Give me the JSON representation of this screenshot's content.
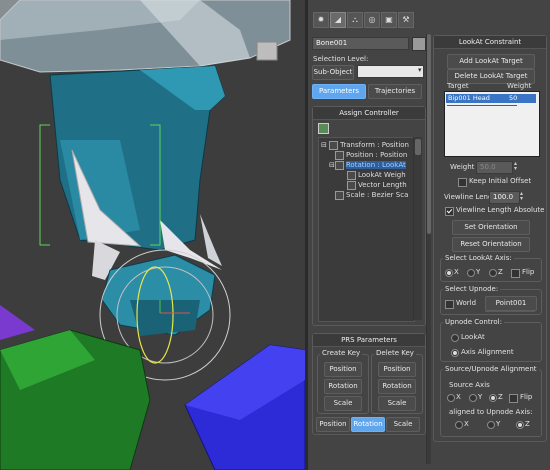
{
  "modify_panel": {
    "object_name": "Bone001",
    "selection_level_label": "Selection Level:",
    "sub_object_label": "Sub-Object",
    "sub_object_value": "",
    "tabs": {
      "parameters": "Parameters",
      "trajectories": "Trajectories"
    },
    "assign_controller": {
      "title": "Assign Controller",
      "tree": [
        "Transform : Position",
        "Position : Position",
        "Rotation : LookAt",
        "LookAt Weigh",
        "Vector Length",
        "Scale : Bezier Sca"
      ]
    },
    "prs": {
      "title": "PRS Parameters",
      "create_key_label": "Create Key",
      "delete_key_label": "Delete Key",
      "create_buttons": [
        "Position",
        "Rotation",
        "Scale"
      ],
      "delete_buttons": [
        "Position",
        "Rotation",
        "Scale"
      ],
      "bottom_tabs": [
        "Position",
        "Rotation",
        "Scale"
      ]
    }
  },
  "lookat": {
    "title": "LookAt Constraint",
    "add_target": "Add LookAt Target",
    "delete_target": "Delete LookAt Target",
    "col_target": "Target",
    "col_weight": "Weight",
    "target_row": {
      "target": "Bip001 Head",
      "weight": "50"
    },
    "weight_label": "Weight",
    "weight_value": "50.0",
    "keep_initial_offset": "Keep Initial Offset",
    "viewline_length_label": "Viewline Length",
    "viewline_length_value": "100.0",
    "viewline_length_absolute": "Viewline Length Absolute",
    "set_orientation": "Set Orientation",
    "reset_orientation": "Reset Orientation",
    "select_axis_title": "Select LookAt Axis:",
    "axis_x": "X",
    "axis_y": "Y",
    "axis_z": "Z",
    "flip": "Flip",
    "select_upnode_title": "Select Upnode:",
    "world": "World",
    "upnode_button": "Point001",
    "upnode_control_title": "Upnode Control:",
    "lookat_option": "LookAt",
    "axis_alignment_option": "Axis Alignment",
    "source_upnode_title": "Source/Upnode Alignment",
    "source_axis_label": "Source Axis",
    "source_x": "X",
    "source_y": "Y",
    "source_z": "Z",
    "source_flip": "Flip",
    "aligned_label": "aligned to Upnode Axis:",
    "aligned_x": "X",
    "aligned_y": "Y",
    "aligned_z": "Z"
  },
  "colors": {
    "accent": "#5fa6ee",
    "red_marker": "#d22222"
  }
}
